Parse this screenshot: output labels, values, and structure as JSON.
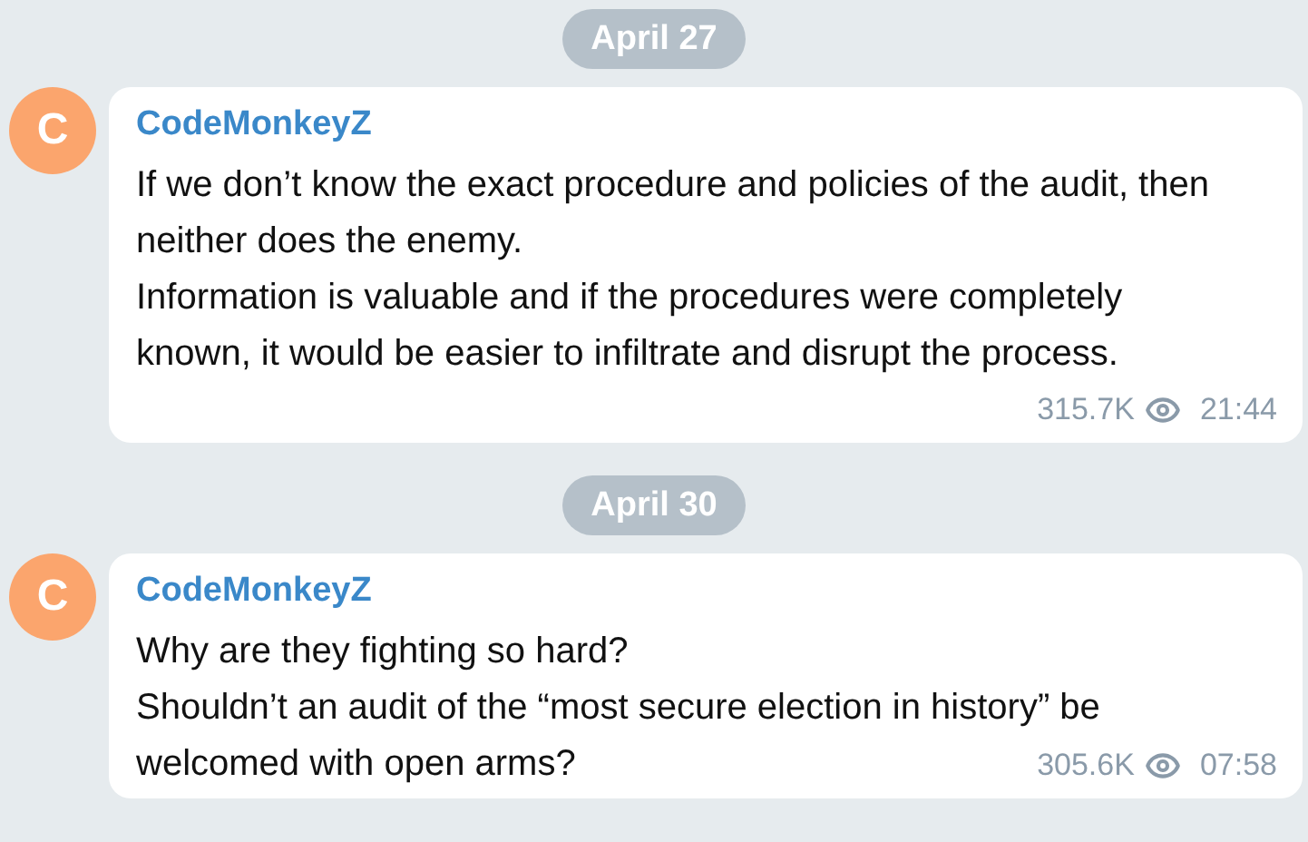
{
  "feed": [
    {
      "date": "April 27",
      "message": {
        "author": "CodeMonkeyZ",
        "avatar_letter": "C",
        "lines": [
          "If we don’t know the exact procedure and policies of the audit, then",
          "neither does the enemy.",
          "Information is valuable and if the procedures were completely",
          "known, it would be easier to infiltrate and disrupt the process."
        ],
        "views": "315.7K",
        "time": "21:44"
      }
    },
    {
      "date": "April 30",
      "message": {
        "author": "CodeMonkeyZ",
        "avatar_letter": "C",
        "lines": [
          "Why are they fighting so hard?",
          "Shouldn’t an audit of the “most secure election in history” be",
          "welcomed with open arms?"
        ],
        "views": "305.6K",
        "time": "07:58"
      }
    }
  ]
}
